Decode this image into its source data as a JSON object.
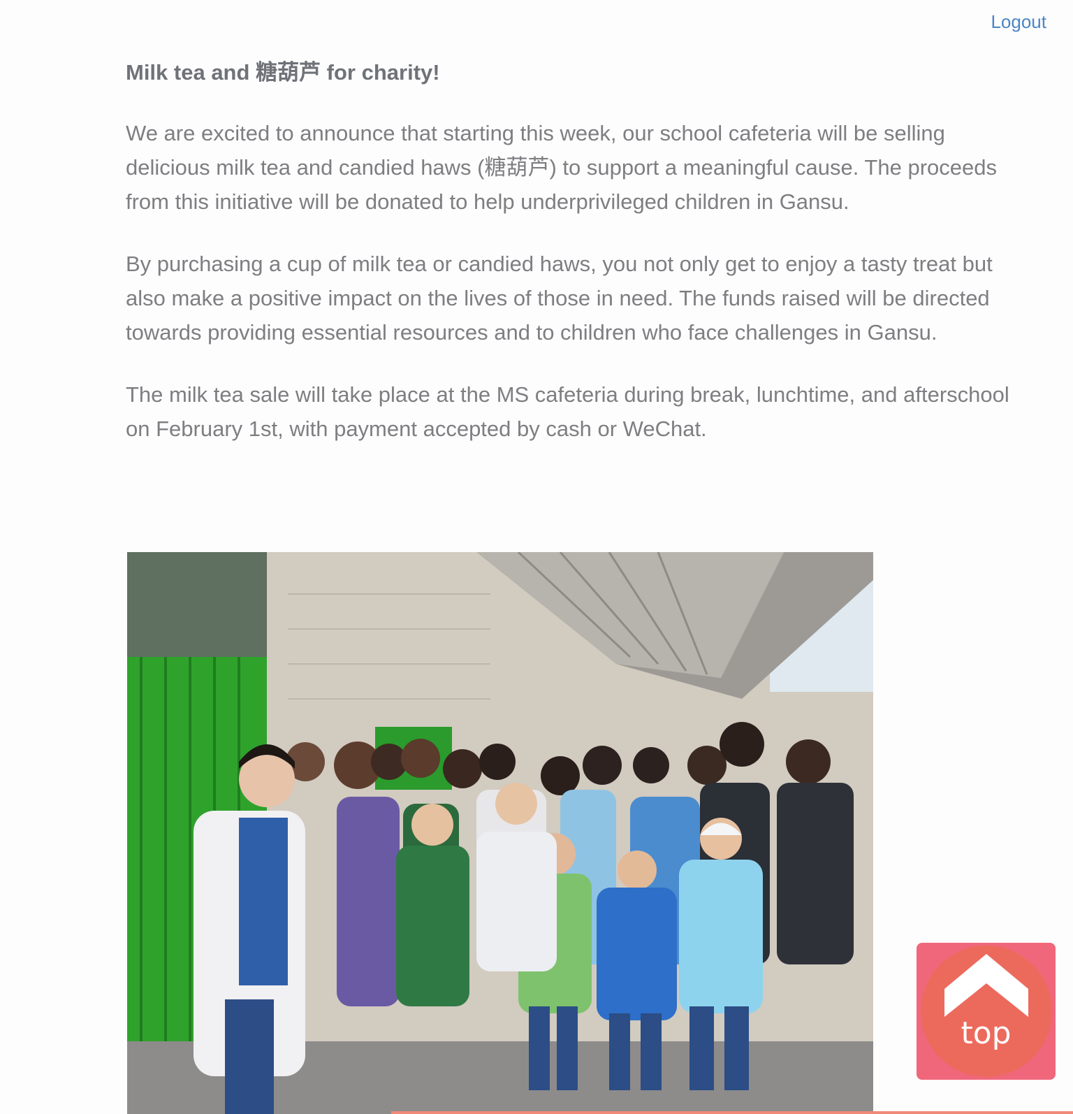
{
  "header": {
    "logout_label": "Logout"
  },
  "article": {
    "title": "Milk tea and 糖葫芦 for charity!",
    "paragraphs": [
      "We are excited to announce that starting this week, our school cafeteria will be selling delicious milk tea and candied haws (糖葫芦) to support a meaningful cause. The proceeds from this initiative will be donated to help underprivileged children in Gansu.",
      "By purchasing a cup of milk tea or candied haws, you not only get to enjoy a tasty treat but also make a positive impact on the lives of those in need. The funds raised will be directed towards providing essential resources and to children who face challenges in Gansu.",
      "The milk tea sale will take place at the MS cafeteria during break, lunchtime, and afterschool on February 1st, with payment accepted by cash or WeChat."
    ]
  },
  "back_to_top": {
    "label": "top"
  },
  "colors": {
    "link": "#4a86c5",
    "top_button_bg": "#f0677b",
    "top_button_circle": "#ec6a5c",
    "text": "#7e7e82"
  }
}
